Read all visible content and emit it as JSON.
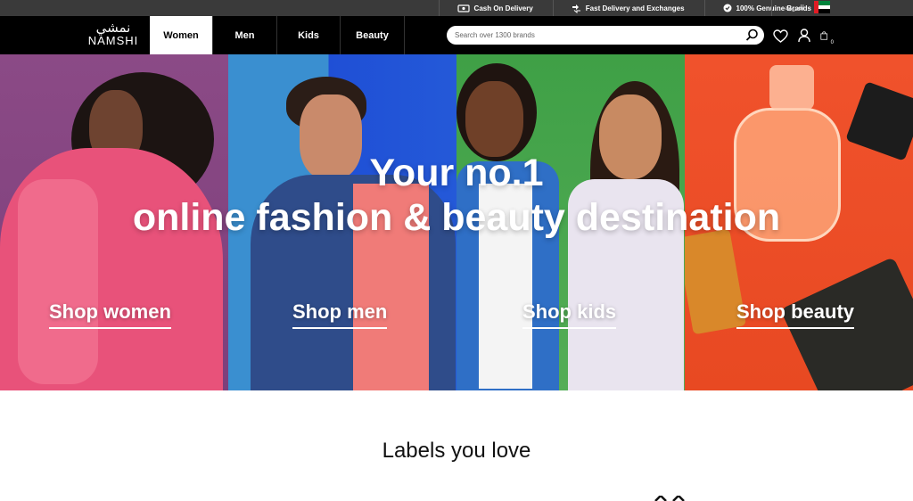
{
  "topbar": {
    "items": [
      {
        "icon": "cash-icon",
        "label": "Cash On Delivery"
      },
      {
        "icon": "delivery-icon",
        "label": "Fast Delivery and Exchanges"
      },
      {
        "icon": "check-badge-icon",
        "label": "100% Genuine Brands"
      }
    ],
    "language_label": "العربية",
    "flag": "uae-flag-icon"
  },
  "header": {
    "logo": {
      "arabic": "نمشي",
      "english": "NAMSHI"
    },
    "tabs": [
      {
        "label": "Women",
        "active": true
      },
      {
        "label": "Men",
        "active": false
      },
      {
        "label": "Kids",
        "active": false
      },
      {
        "label": "Beauty",
        "active": false
      }
    ],
    "search": {
      "placeholder": "Search over 1300 brands",
      "value": ""
    },
    "icons": [
      "heart-icon",
      "user-icon",
      "bag-icon"
    ],
    "cart_count": "0"
  },
  "hero": {
    "title_line1": "Your no.1",
    "title_line2": "online fashion & beauty destination",
    "panels": [
      {
        "link": "Shop women",
        "color": "#8b4a86"
      },
      {
        "link": "Shop men",
        "color": "#2459d8"
      },
      {
        "link": "Shop kids",
        "color": "#46a24b"
      },
      {
        "link": "Shop beauty",
        "color": "#ee5028"
      }
    ]
  },
  "section": {
    "title": "Labels you love"
  },
  "colors": {
    "header_bg": "#000000",
    "topbar_bg": "#3a3a3a",
    "accent_white": "#ffffff"
  }
}
